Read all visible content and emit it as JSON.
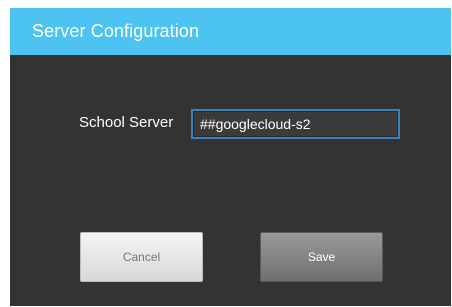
{
  "dialog": {
    "title": "Server Configuration",
    "accent_color": "#4dc3f2",
    "background_color": "#333333"
  },
  "form": {
    "school_server_label": "School Server",
    "school_server_value": "##googlecloud-s2"
  },
  "buttons": {
    "cancel_label": "Cancel",
    "save_label": "Save"
  }
}
